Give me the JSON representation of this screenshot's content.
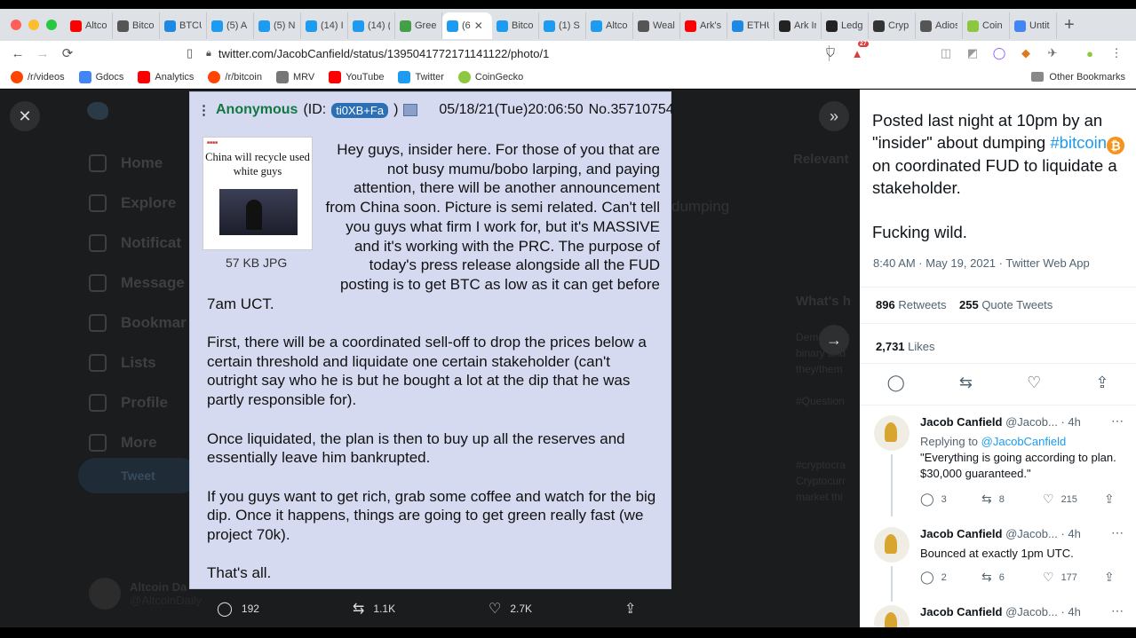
{
  "browser": {
    "colors": {
      "close": "#ff5f57",
      "min": "#febc2e",
      "max": "#28c840",
      "tabbar": "#dee1e6"
    },
    "tabs": [
      {
        "label": "Altco",
        "icon": "youtube-icon",
        "color": "#ff0000"
      },
      {
        "label": "Bitco",
        "icon": "wayback-icon",
        "color": "#555555"
      },
      {
        "label": "BTCU",
        "icon": "cloud-icon",
        "color": "#1e88e5"
      },
      {
        "label": "(5) A",
        "icon": "twitter-icon",
        "color": "#1d9bf0"
      },
      {
        "label": "(5) N",
        "icon": "twitter-icon",
        "color": "#1d9bf0"
      },
      {
        "label": "(14) I",
        "icon": "twitter-icon",
        "color": "#1d9bf0"
      },
      {
        "label": "(14) (",
        "icon": "twitter-icon",
        "color": "#1d9bf0"
      },
      {
        "label": "Green",
        "icon": "green-icon",
        "color": "#43a047"
      },
      {
        "label": "(6",
        "icon": "twitter-icon",
        "color": "#1d9bf0",
        "active": true
      },
      {
        "label": "Bitco",
        "icon": "twitter-icon",
        "color": "#1d9bf0"
      },
      {
        "label": "(1) S",
        "icon": "twitter-icon",
        "color": "#1d9bf0"
      },
      {
        "label": "Altco",
        "icon": "twitter-icon",
        "color": "#1d9bf0"
      },
      {
        "label": "Weal",
        "icon": "wayback-icon",
        "color": "#555555"
      },
      {
        "label": "Ark's",
        "icon": "youtube-icon",
        "color": "#ff0000"
      },
      {
        "label": "ETHU",
        "icon": "cloud-icon",
        "color": "#1e88e5"
      },
      {
        "label": "Ark In",
        "icon": "ark-icon",
        "color": "#222222"
      },
      {
        "label": "Ledg",
        "icon": "ledger-icon",
        "color": "#222222"
      },
      {
        "label": "Cryp",
        "icon": "grid-icon",
        "color": "#333333"
      },
      {
        "label": "Adios",
        "icon": "wayback-icon",
        "color": "#555555"
      },
      {
        "label": "Coin",
        "icon": "coingecko-icon",
        "color": "#8dc63f"
      },
      {
        "label": "Untit",
        "icon": "doc-icon",
        "color": "#4285f4"
      }
    ],
    "url": "twitter.com/JacobCanfield/status/1395041772171141122/photo/1",
    "notification_badge": "27",
    "bookmarks": [
      {
        "label": "/r/videos",
        "icon": "reddit-icon",
        "color": "#ff4500"
      },
      {
        "label": "Gdocs",
        "icon": "doc-icon",
        "color": "#4285f4"
      },
      {
        "label": "Analytics",
        "icon": "youtube-icon",
        "color": "#ff0000"
      },
      {
        "label": "/r/bitcoin",
        "icon": "reddit-icon",
        "color": "#ff4500"
      },
      {
        "label": "MRV",
        "icon": "image-icon",
        "color": "#777777"
      },
      {
        "label": "YouTube",
        "icon": "youtube-icon",
        "color": "#ff0000"
      },
      {
        "label": "Twitter",
        "icon": "twitter-icon",
        "color": "#1d9bf0"
      },
      {
        "label": "CoinGecko",
        "icon": "coingecko-icon",
        "color": "#8dc63f"
      }
    ],
    "other_bookmarks": "Other Bookmarks"
  },
  "background": {
    "nav": [
      "Home",
      "Explore",
      "Notificat",
      "Message",
      "Bookmar",
      "Lists",
      "Profile",
      "More"
    ],
    "tweet_button": "Tweet",
    "account_name": "Altcoin Da",
    "account_handle": "@AltcoinDaily",
    "relevant": "Relevant",
    "whats": "What's h",
    "ghost_text": "dumping",
    "sidebar_lines": [
      "Demi Lovat",
      "binary and",
      "they/them",
      "",
      "#Question",
      "",
      "",
      "",
      "#cryptocra",
      "Cryptocurr",
      "market thi"
    ]
  },
  "chan": {
    "name": "Anonymous",
    "id_prefix": "(ID:",
    "id": "ti0XB+Fa",
    "id_suffix": ")",
    "datetime": "05/18/21(Tue)20:06:50",
    "post_no": "No.35710754",
    "thumb_headline": "China will recycle used white guys",
    "file_size": "57 KB JPG",
    "paragraphs": [
      "Hey guys, insider here. For those of you that are not busy mumu/bobo larping, and paying attention, there will be another announcement from China soon. Picture is semi related. Can't tell you guys what firm I work for, but it's MASSIVE and it's working with the PRC. The purpose of today's press release alongside all the FUD posting is to get BTC as low as it can get before 7am UCT.",
      "First, there will be a coordinated sell-off to drop the prices below a certain threshold and liquidate one certain stakeholder (can't outright say who he is but he bought a lot at the dip that he was partly responsible for).",
      "Once liquidated, the plan is then to buy up all the reserves and essentially leave him bankrupted.",
      "If you guys want to get rich, grab some coffee and watch for the big dip. Once it happens, things are going to get green really fast (we project 70k).",
      "That's all."
    ]
  },
  "media_actions": {
    "replies": "192",
    "retweets": "1.1K",
    "likes": "2.7K"
  },
  "tweet": {
    "text_before": "Posted last night at 10pm by an \"insider\" about dumping ",
    "hashtag": "#bitcoin",
    "btc_symbol": "₿",
    "text_after": " on coordinated FUD to liquidate a stakeholder.",
    "text2": "Fucking wild.",
    "meta": "8:40 AM · May 19, 2021 · Twitter Web App",
    "retweets_count": "896",
    "retweets_label": "Retweets",
    "quotes_count": "255",
    "quotes_label": "Quote Tweets",
    "likes_count": "2,731",
    "likes_label": "Likes"
  },
  "replies": [
    {
      "name": "Jacob Canfield",
      "handle": "@Jacob...",
      "time": "· 4h",
      "replying_prefix": "Replying to ",
      "replying_to": "@JacobCanfield",
      "text": "\"Everything is going according to plan. $30,000 guaranteed.\"",
      "replies": "3",
      "retweets": "8",
      "likes": "215"
    },
    {
      "name": "Jacob Canfield",
      "handle": "@Jacob...",
      "time": "· 4h",
      "text": "Bounced at exactly 1pm UTC.",
      "replies": "2",
      "retweets": "6",
      "likes": "177"
    },
    {
      "name": "Jacob Canfield",
      "handle": "@Jacob...",
      "time": "· 4h"
    }
  ]
}
